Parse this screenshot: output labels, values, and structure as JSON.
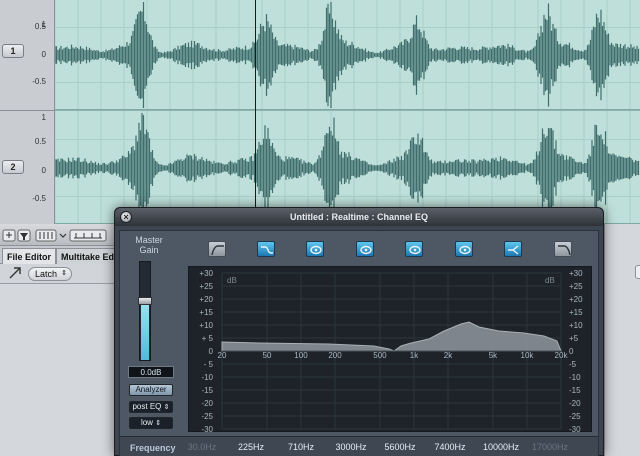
{
  "tracks": [
    {
      "number": "1",
      "scale": [
        "1",
        "0.5",
        "0",
        "-0.5"
      ]
    },
    {
      "number": "2",
      "scale": [
        "1",
        "0.5",
        "0",
        "-0.5"
      ]
    }
  ],
  "editor": {
    "tabs": [
      "File Editor",
      "Multitake Edi"
    ],
    "automation_mode": "Latch"
  },
  "plugin": {
    "title": "Untitled : Realtime : Channel EQ",
    "close_glyph": "×",
    "master_gain": {
      "label": "Master Gain",
      "value": "0.0dB",
      "level": 0.6
    },
    "analyzer_label": "Analyzer",
    "analyzer_mode": "post EQ",
    "resolution": "low",
    "graph": {
      "db_ticks_left": [
        "+30",
        "+25",
        "+20",
        "+15",
        "+10",
        "+ 5",
        "0",
        "- 5",
        "-10",
        "-15",
        "-20",
        "-25",
        "-30"
      ],
      "db_ticks_right": [
        "+30",
        "+25",
        "+20",
        "+15",
        "+10",
        "+5",
        "0",
        "-5",
        "-10",
        "-15",
        "-20",
        "-25",
        "-30"
      ],
      "unit_left": "dB",
      "unit_right": "dB",
      "freq_ticks": [
        "20",
        "50",
        "100",
        "200",
        "500",
        "1k",
        "2k",
        "5k",
        "10k",
        "20k"
      ]
    },
    "frequency_label": "Frequency",
    "bands": [
      {
        "name": "low-cut",
        "freq": "30.0Hz",
        "enabled": false
      },
      {
        "name": "low-shelf",
        "freq": "225Hz",
        "enabled": true
      },
      {
        "name": "peak-1",
        "freq": "710Hz",
        "enabled": true
      },
      {
        "name": "peak-2",
        "freq": "3000Hz",
        "enabled": true
      },
      {
        "name": "peak-3",
        "freq": "5600Hz",
        "enabled": true
      },
      {
        "name": "peak-4",
        "freq": "7400Hz",
        "enabled": true
      },
      {
        "name": "high-shelf",
        "freq": "10000Hz",
        "enabled": true
      },
      {
        "name": "high-cut",
        "freq": "17000Hz",
        "enabled": false
      }
    ]
  }
}
